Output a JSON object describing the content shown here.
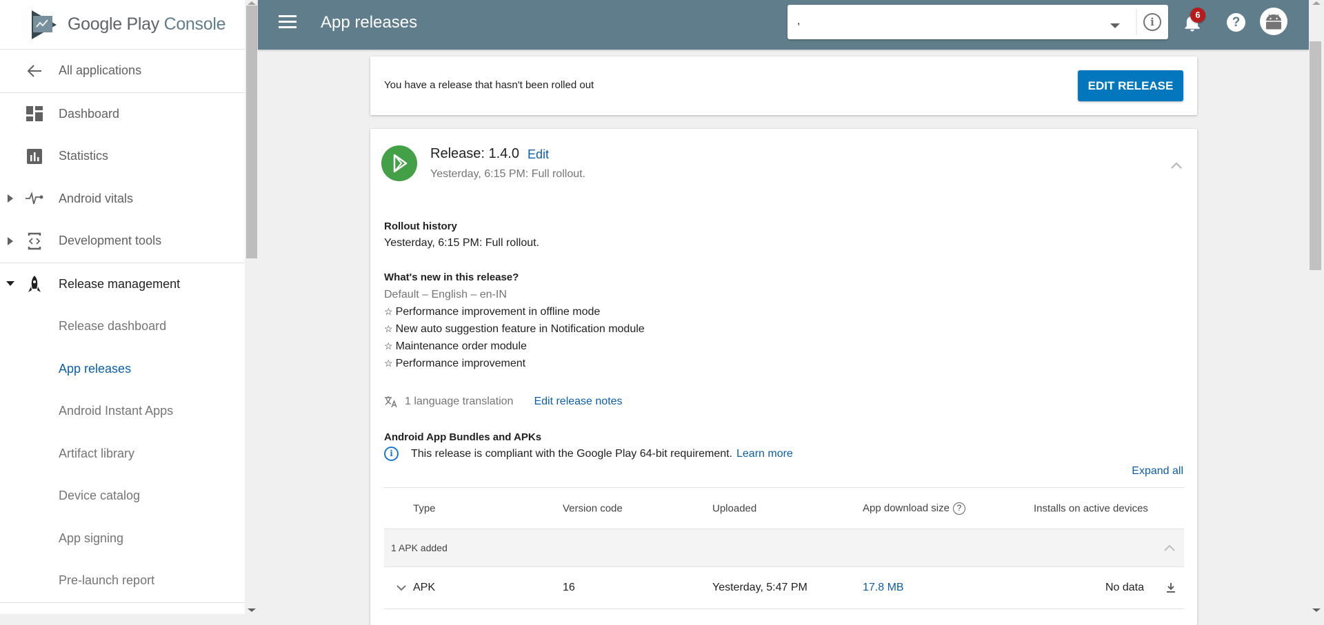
{
  "sidebar": {
    "brand_google_play": "Google Play",
    "brand_console": "Console",
    "back_label": "All applications",
    "items": [
      {
        "label": "Dashboard",
        "icon": "dashboard-icon"
      },
      {
        "label": "Statistics",
        "icon": "bar-chart-icon"
      },
      {
        "label": "Android vitals",
        "icon": "vitals-pulse-icon",
        "expandable": true
      },
      {
        "label": "Development tools",
        "icon": "code-brackets-icon",
        "expandable": true
      },
      {
        "label": "Release management",
        "icon": "rocket-icon",
        "expanded": true
      }
    ],
    "subitems": [
      {
        "label": "Release dashboard"
      },
      {
        "label": "App releases",
        "active": true
      },
      {
        "label": "Android Instant Apps"
      },
      {
        "label": "Artifact library"
      },
      {
        "label": "Device catalog"
      },
      {
        "label": "App signing"
      },
      {
        "label": "Pre-launch report"
      }
    ]
  },
  "header": {
    "title": "App releases",
    "app_selector_value": "  ,",
    "notifications_count": "6",
    "help_glyph": "?",
    "info_glyph": "i"
  },
  "banner": {
    "message": "You have a release that hasn't been rolled out",
    "button_label": "EDIT RELEASE"
  },
  "release": {
    "title": "Release: 1.4.0",
    "edit_label": "Edit",
    "subtitle": "Yesterday, 6:15 PM: Full rollout.",
    "rollout_history_title": "Rollout history",
    "rollout_history_text": "Yesterday, 6:15 PM: Full rollout.",
    "whats_new_title": "What's new in this release?",
    "language_label": "Default – English – en-IN",
    "notes": [
      "Performance improvement in offline mode",
      "New auto suggestion feature in Notification module",
      "Maintenance order module",
      "Performance improvement"
    ],
    "note_bullet": "☆",
    "translation_count": "1 language translation",
    "edit_notes_label": "Edit release notes",
    "bundles_title": "Android App Bundles and APKs",
    "compliance_text": "This release is compliant with the Google Play 64-bit requirement.",
    "learn_more_label": "Learn more",
    "expand_all_label": "Expand all"
  },
  "table": {
    "columns": [
      "Type",
      "Version code",
      "Uploaded",
      "App download size",
      "Installs on active devices"
    ],
    "group_label": "1 APK added",
    "rows": [
      {
        "type": "APK",
        "version_code": "16",
        "uploaded": "Yesterday, 5:47 PM",
        "size": "17.8 MB",
        "installs": "No data"
      }
    ]
  }
}
